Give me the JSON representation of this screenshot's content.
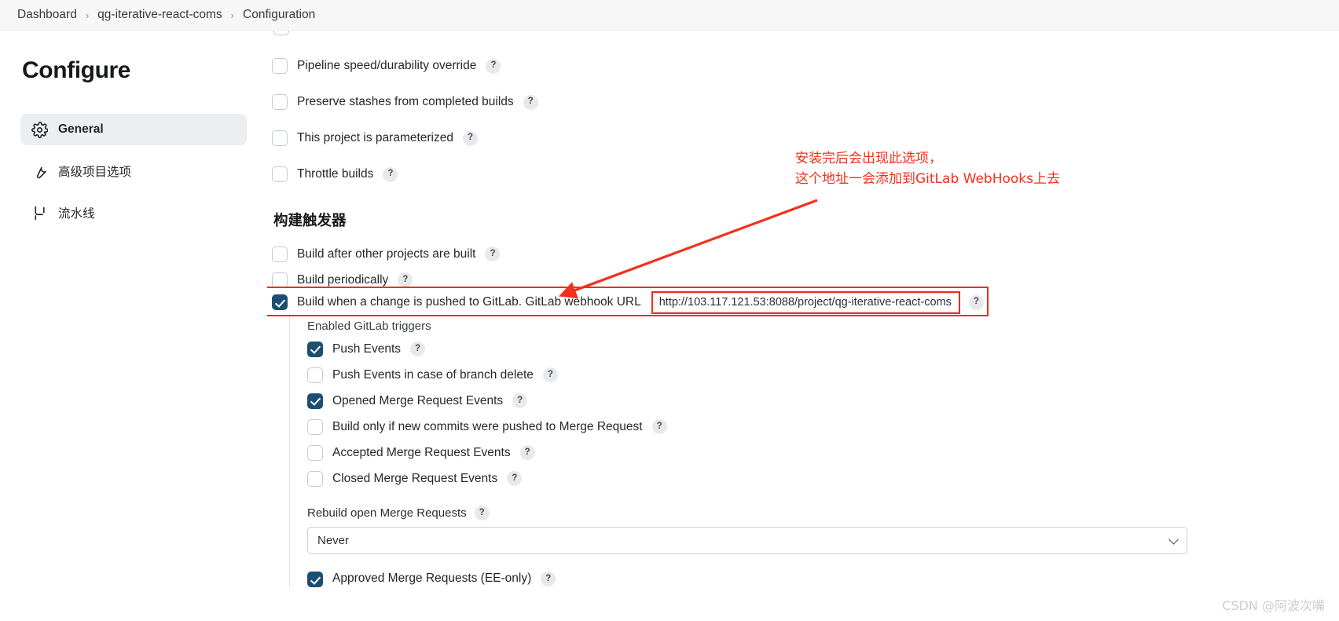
{
  "breadcrumb": {
    "items": [
      "Dashboard",
      "qg-iterative-react-coms",
      "Configuration"
    ],
    "separator": "›"
  },
  "sidebar": {
    "title": "Configure",
    "items": [
      {
        "label": "General",
        "icon": "gear-icon",
        "active": true
      },
      {
        "label": "高级项目选项",
        "icon": "wrench-icon",
        "active": false
      },
      {
        "label": "流水线",
        "icon": "pipeline-icon",
        "active": false
      }
    ]
  },
  "main": {
    "top_options": [
      {
        "label": "Pipeline speed/durability override",
        "checked": false,
        "help": "?"
      },
      {
        "label": "Preserve stashes from completed builds",
        "checked": false,
        "help": "?"
      },
      {
        "label": "This project is parameterized",
        "checked": false,
        "help": "?"
      },
      {
        "label": "Throttle builds",
        "checked": false,
        "help": "?"
      }
    ],
    "triggers_heading": "构建触发器",
    "trigger_options": [
      {
        "label": "Build after other projects are built",
        "checked": false,
        "help": "?"
      },
      {
        "label": "Build periodically",
        "checked": false,
        "help": "?"
      }
    ],
    "webhook": {
      "checked": true,
      "label": "Build when a change is pushed to GitLab. GitLab webhook URL",
      "url": "http://103.117.121.53:8088/project/qg-iterative-react-coms",
      "help": "?",
      "highlight_color": "#f22b1b"
    },
    "gitlab_triggers": {
      "label": "Enabled GitLab triggers",
      "items": [
        {
          "label": "Push Events",
          "checked": true,
          "help": "?"
        },
        {
          "label": "Push Events in case of branch delete",
          "checked": false,
          "help": "?"
        },
        {
          "label": "Opened Merge Request Events",
          "checked": true,
          "help": "?"
        },
        {
          "label": "Build only if new commits were pushed to Merge Request",
          "checked": false,
          "help": "?"
        },
        {
          "label": "Accepted Merge Request Events",
          "checked": false,
          "help": "?"
        },
        {
          "label": "Closed Merge Request Events",
          "checked": false,
          "help": "?"
        }
      ]
    },
    "rebuild": {
      "label": "Rebuild open Merge Requests",
      "help": "?",
      "value": "Never",
      "options": [
        "Never"
      ]
    },
    "bottom_partial": {
      "label": "Approved Merge Requests (EE-only)",
      "checked": true,
      "help": "?"
    }
  },
  "annotation": {
    "line1": "安装完后会出现此选项，",
    "line2": "这个地址一会添加到GitLab WebHooks上去",
    "color": "#f4301c"
  },
  "watermark": "CSDN @阿波次嘴"
}
